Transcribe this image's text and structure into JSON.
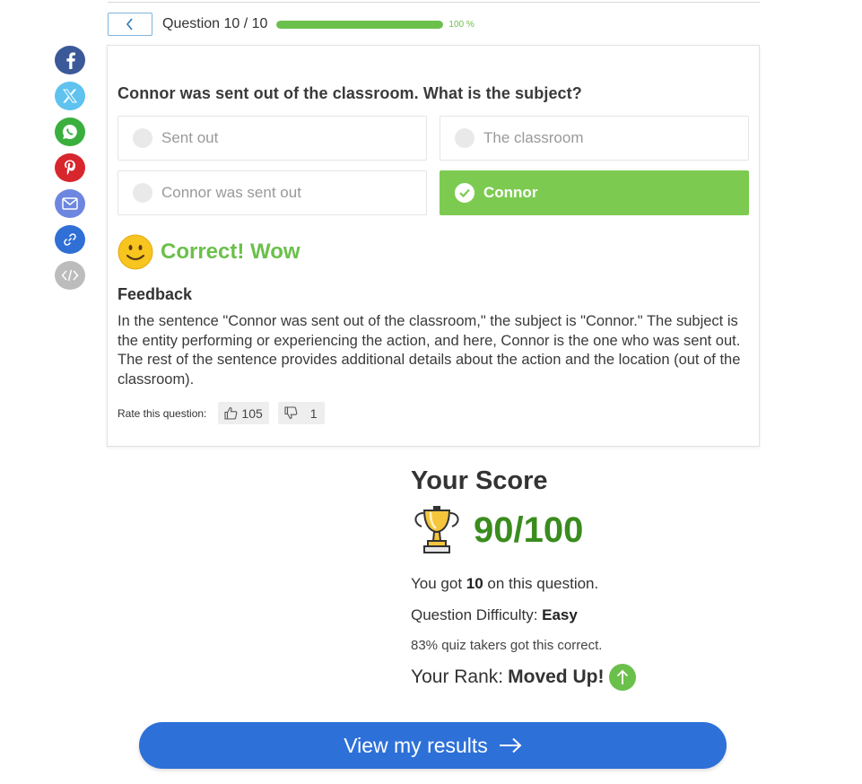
{
  "header": {
    "counter": "Question 10 / 10",
    "progress_percent": 100,
    "progress_label": "100 %"
  },
  "share": {
    "colors": {
      "facebook": "#3b5998",
      "x": "#5fc2ef",
      "whatsapp": "#3aaf3e",
      "pinterest": "#d7262c",
      "email": "#6d86e0",
      "link": "#2f6fd6",
      "embed": "#bcbcbc"
    }
  },
  "question": {
    "text": "Connor was sent out of the classroom. What is the subject?",
    "options": [
      {
        "label": "Sent out",
        "selected": false
      },
      {
        "label": "The classroom",
        "selected": false
      },
      {
        "label": "Connor was sent out",
        "selected": false
      },
      {
        "label": "Connor",
        "selected": true
      }
    ]
  },
  "result": {
    "text": "Correct! Wow"
  },
  "feedback": {
    "heading": "Feedback",
    "body": "In the sentence \"Connor was sent out of the classroom,\" the subject is \"Connor.\" The subject is the entity performing or experiencing the action, and here, Connor is the one who was sent out. The rest of the sentence provides additional details about the action and the location (out of the classroom)."
  },
  "rating": {
    "label": "Rate this question:",
    "up_count": "105",
    "down_count": "1"
  },
  "score": {
    "title": "Your Score",
    "value": "90/100",
    "got_prefix": "You got ",
    "got_value": "10",
    "got_suffix": " on this question.",
    "difficulty_label": "Question Difficulty: ",
    "difficulty_value": "Easy",
    "percent_line": "83% quiz takers got this correct.",
    "rank_label": "Your Rank: ",
    "rank_value": "Moved Up!"
  },
  "cta": {
    "label": "View my results"
  },
  "colors": {
    "accent_green": "#7ccb50",
    "score_green": "#3a8c1e",
    "primary_blue": "#2d70d8"
  }
}
